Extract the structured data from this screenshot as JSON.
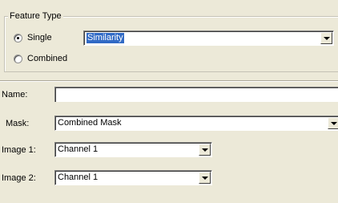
{
  "feature_type": {
    "legend": "Feature Type",
    "options": [
      {
        "label": "Single",
        "selected": true
      },
      {
        "label": "Combined",
        "selected": false
      }
    ],
    "single_combo_value": "Similarity"
  },
  "name": {
    "label": "Name:",
    "value": ""
  },
  "mask": {
    "label": "Mask:",
    "value": "Combined Mask"
  },
  "image1": {
    "label": "Image 1:",
    "value": "Channel 1"
  },
  "image2": {
    "label": "Image 2:",
    "value": "Channel 1"
  },
  "icons": {
    "dropdown": "chevron-down-icon",
    "radio_selected": "radio-selected-icon",
    "radio_unselected": "radio-unselected-icon"
  }
}
